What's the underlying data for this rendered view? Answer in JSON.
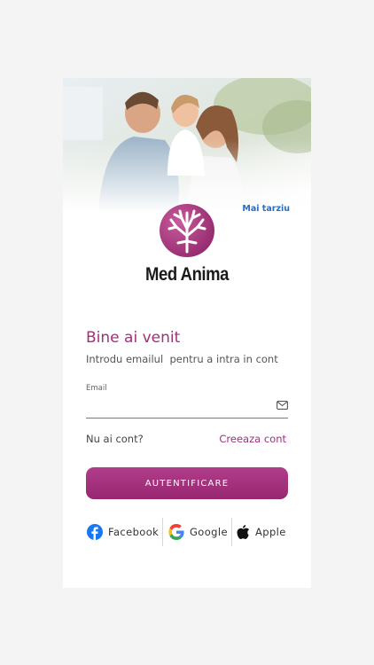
{
  "header": {
    "skip_label": "Mai tarziu"
  },
  "brand": {
    "name": "Med Anima",
    "accent_color": "#a0307a"
  },
  "welcome": {
    "title": "Bine ai venit",
    "subtitle": "Introdu emailul  pentru a intra in cont"
  },
  "form": {
    "email_label": "Email",
    "email_value": "",
    "email_icon": "mail-icon"
  },
  "account": {
    "prompt": "Nu ai cont?",
    "create_label": "Creeaza cont"
  },
  "login": {
    "label": "AUTENTIFICARE"
  },
  "social": {
    "facebook": {
      "label": "Facebook",
      "icon": "facebook-icon"
    },
    "google": {
      "label": "Google",
      "icon": "google-icon"
    },
    "apple": {
      "label": "Apple",
      "icon": "apple-icon"
    }
  }
}
